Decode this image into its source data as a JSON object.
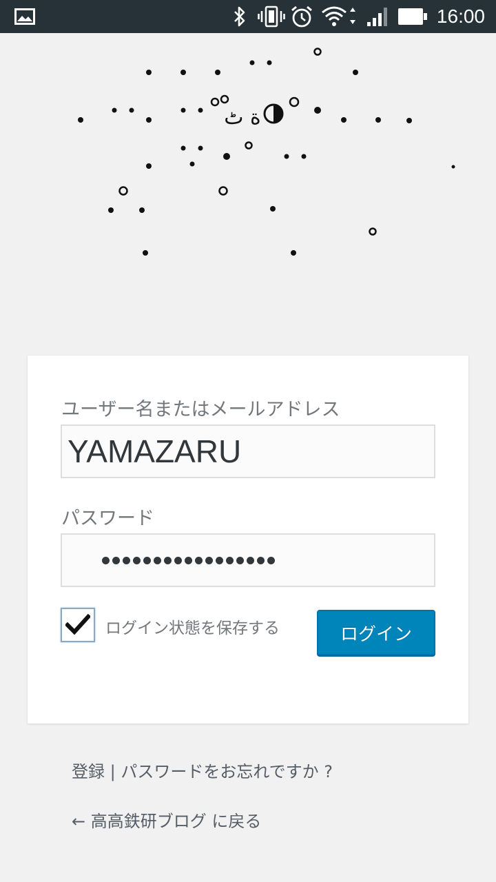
{
  "status_bar": {
    "time": "16:00",
    "icons": [
      "image-icon",
      "bluetooth-icon",
      "vibrate-icon",
      "alarm-icon",
      "wifi-icon",
      "signal-icon",
      "battery-icon"
    ]
  },
  "logo": {
    "glyph": "ة ٹ",
    "description_icon": "dotted-logo-icon"
  },
  "form": {
    "username_label": "ユーザー名またはメールアドレス",
    "username_value": "YAMAZARU",
    "password_label": "パスワード",
    "password_dot_count": 17,
    "remember_label": "ログイン状態を保存する",
    "remember_checked": true,
    "login_button": "ログイン"
  },
  "footer": {
    "register_link": "登録",
    "separator": " | ",
    "lost_password_link": "パスワードをお忘れですか ?",
    "back_link": "← 高高鉄研ブログ に戻る"
  },
  "colors": {
    "status_bar_bg": "#263238",
    "page_bg": "#f1f1f1",
    "button_bg": "#0085ba",
    "label_text": "#72777c"
  }
}
